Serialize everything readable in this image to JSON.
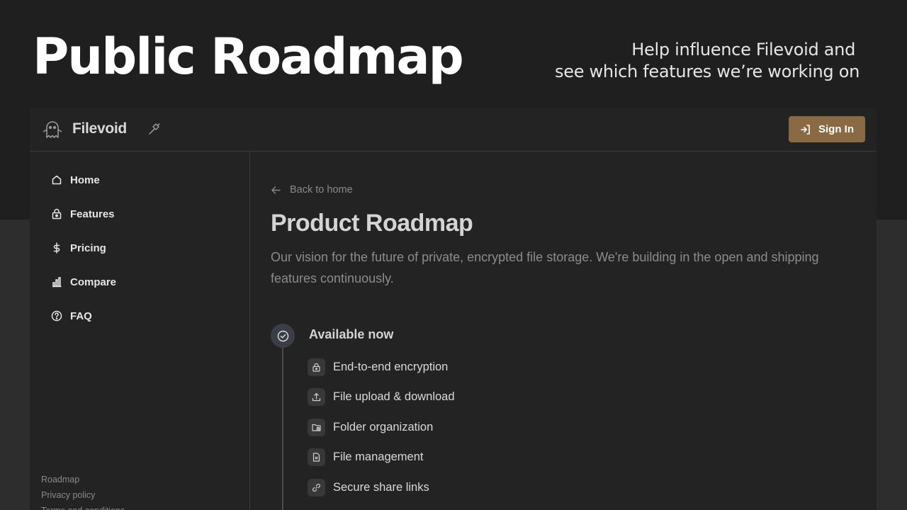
{
  "hero": {
    "title": "Public Roadmap",
    "subtitle_line1": "Help influence Filevoid and",
    "subtitle_line2": "see which features we’re working on"
  },
  "app": {
    "brand": "Filevoid",
    "signin_label": "Sign In",
    "accent_color": "#8a6a44"
  },
  "sidebar": {
    "items": [
      {
        "label": "Home",
        "icon": "home-icon"
      },
      {
        "label": "Features",
        "icon": "lock-icon"
      },
      {
        "label": "Pricing",
        "icon": "dollar-icon"
      },
      {
        "label": "Compare",
        "icon": "bar-chart-icon"
      },
      {
        "label": "FAQ",
        "icon": "help-circle-icon"
      }
    ],
    "footer_links": [
      "Roadmap",
      "Privacy policy",
      "Terms and conditions"
    ]
  },
  "main": {
    "back_label": "Back to home",
    "title": "Product Roadmap",
    "description": "Our vision for the future of private, encrypted file storage. We're building in the open and shipping features continuously.",
    "section_title": "Available now",
    "features": [
      {
        "label": "End-to-end encryption",
        "icon": "lock-icon"
      },
      {
        "label": "File upload & download",
        "icon": "upload-icon"
      },
      {
        "label": "Folder organization",
        "icon": "folder-lock-icon"
      },
      {
        "label": "File management",
        "icon": "file-text-icon"
      },
      {
        "label": "Secure share links",
        "icon": "link-icon"
      }
    ]
  }
}
